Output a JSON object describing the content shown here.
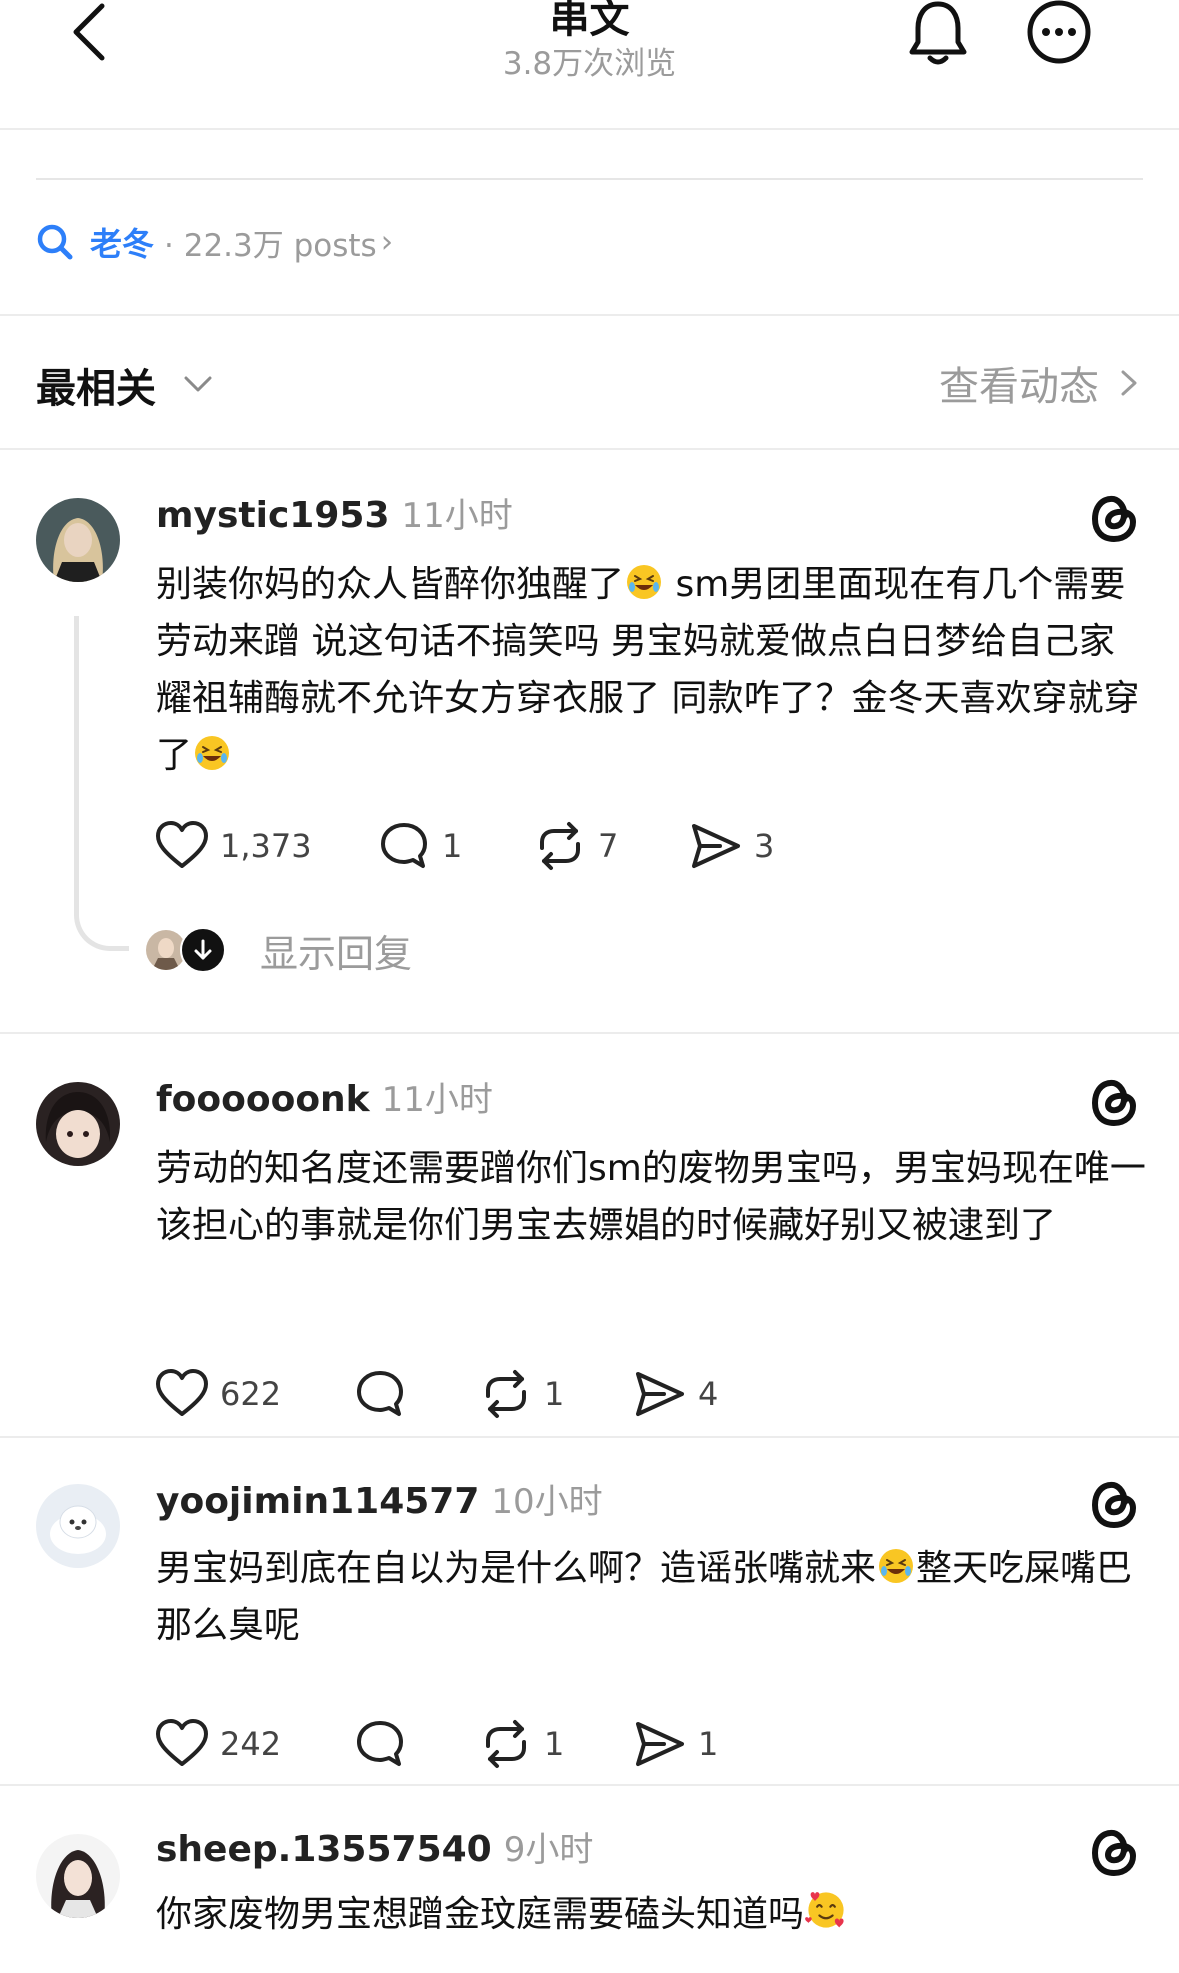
{
  "header": {
    "title": "串文",
    "views": "3.8万次浏览",
    "icons": [
      "back-arrow-icon",
      "bell-icon",
      "more-icon"
    ]
  },
  "topic": {
    "name": "老冬",
    "posts": "· 22.3万 posts",
    "chevron": "›",
    "accent": "#2d7ff9"
  },
  "sort": {
    "label": "最相关",
    "activity": "查看动态"
  },
  "posts": [
    {
      "username": "mystic1953",
      "time": "11小时",
      "segments": [
        "别装你妈的众人皆醉你独醒了",
        " sm男团里面现在有几个需要劳动来蹭 说这句话不搞笑吗 男宝妈就爱做点白日梦给自己家耀祖辅酶就不允许女方穿衣服了 同款咋了？金冬天喜欢穿就穿了"
      ],
      "emoji": [
        "rofl-emoji",
        "rofl-emoji"
      ],
      "likes": "1,373",
      "comments": "1",
      "reposts": "7",
      "shares": "3",
      "show_replies": "显示回复"
    },
    {
      "username": "foooooonk",
      "time": "11小时",
      "text": "劳动的知名度还需要蹭你们sm的废物男宝吗，男宝妈现在唯一该担心的事就是你们男宝去嫖娼的时候藏好别又被逮到了",
      "likes": "622",
      "comments": "",
      "reposts": "1",
      "shares": "4"
    },
    {
      "username": "yoojimin114577",
      "time": "10小时",
      "segments": [
        "男宝妈到底在自以为是什么啊？造谣张嘴就来",
        "整天吃屎嘴巴那么臭呢"
      ],
      "emoji": [
        "joy-emoji"
      ],
      "likes": "242",
      "comments": "",
      "reposts": "1",
      "shares": "1"
    },
    {
      "username": "sheep.13557540",
      "time": "9小时",
      "segments": [
        "你家废物男宝想蹭金玟庭需要磕头知道吗"
      ],
      "emoji": [
        "smiling-face-with-hearts-emoji"
      ]
    }
  ]
}
